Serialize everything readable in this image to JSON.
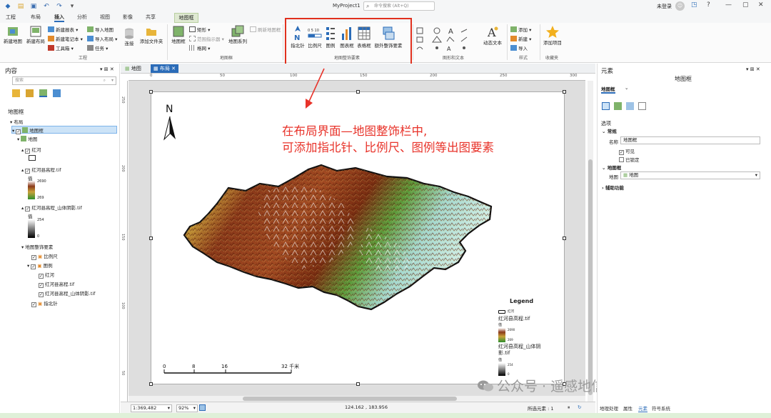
{
  "titlebar": {
    "project_name": "MyProject1",
    "search_placeholder": "命令搜索 (Alt+Q)",
    "login": "未登录",
    "avatar": "☺",
    "help": "?"
  },
  "ribbon_tabs": [
    "工程",
    "布局",
    "插入",
    "分析",
    "视图",
    "影像",
    "共享"
  ],
  "contextual_tab": "地图框",
  "ribbon": {
    "project_group": {
      "new_map": "新建地图",
      "new_layout": "新建布局",
      "new_report": "新建报表",
      "new_notebook": "新建笔记本",
      "toolbox": "工具箱",
      "import_map": "导入地图",
      "import_layout": "导入布局",
      "task": "任务",
      "connect": "连接",
      "add_folder": "添加文件夹",
      "label": "工程"
    },
    "mapframe_group": {
      "map_frame": "地图框",
      "rectangle": "矩形",
      "extent_indicator": "范围指示器",
      "grid": "格网",
      "map_series": "地图系列",
      "refresh": "刷新地图框",
      "label": "地图框"
    },
    "surround_group": {
      "north_arrow": "指北针",
      "scale_bar": "比例尺",
      "legend": "图例",
      "chart_frame": "图表框",
      "table_frame": "表格框",
      "more_elements": "额外整饰要素",
      "label": "地图整饰要素"
    },
    "graphics_group": {
      "dynamic_text": "动态文本",
      "label": "图形和文本"
    },
    "style_group": {
      "add": "添加",
      "new": "新建",
      "import": "导入",
      "label": "样式"
    },
    "favorites_group": {
      "add_item": "添加项目",
      "label": "收藏夹"
    }
  },
  "content_panel": {
    "title": "内容",
    "search_placeholder": "搜索",
    "section": "地图框",
    "tree": [
      {
        "label": "布局"
      },
      {
        "label": "地图框",
        "selected": true
      },
      {
        "label": "地图"
      },
      {
        "label": "红河"
      },
      {
        "label": "红河县高程.tif"
      },
      {
        "label": "值"
      },
      {
        "label": "2690"
      },
      {
        "label": "269"
      },
      {
        "label": "红河县高程_山体阴影.tif"
      },
      {
        "label": "值"
      },
      {
        "label": "254"
      },
      {
        "label": "0"
      },
      {
        "label": "地图整饰要素"
      },
      {
        "label": "比例尺"
      },
      {
        "label": "图例"
      },
      {
        "label": "红河"
      },
      {
        "label": "红河县高程.tif"
      },
      {
        "label": "红河县高程_山体阴影.tif"
      },
      {
        "label": "指北针"
      }
    ]
  },
  "doc_tabs": [
    "地图",
    "布局"
  ],
  "ruler_top": [
    "0",
    "50",
    "100",
    "150",
    "200",
    "250",
    "300"
  ],
  "ruler_left": [
    "250",
    "200",
    "150",
    "100",
    "50"
  ],
  "layout": {
    "north_label": "N",
    "annotation_line1": "在布局界面—地图整饰栏中,",
    "annotation_line2": "可添加指北针、比例尺、图例等出图要素",
    "scalebar_labels": [
      "0",
      "8",
      "16",
      "32 千米"
    ],
    "legend": {
      "title": "Legend",
      "items": [
        "红河",
        "红河县高程.tif",
        "值",
        "2690",
        "269",
        "红河县高程_山体阴影.tif",
        "值",
        "254",
        "0"
      ]
    },
    "watermark": "公众号 · 遥感地信是一家"
  },
  "status_bar": {
    "scale": "1:369,482",
    "zoom": "92%",
    "coords": "124.162 , 183.956",
    "selected": "所选元素 : 1"
  },
  "elements_panel": {
    "title": "元素",
    "subtitle": "地图框",
    "tab": "地图框",
    "options": "选项",
    "general": "常规",
    "name_label": "名称",
    "name_value": "地图框",
    "visible": "可见",
    "locked": "已锁定",
    "mapframe_section": "地图框",
    "map_label": "地图",
    "map_value": "地图",
    "aux": "辅助功能"
  },
  "bottom_tabs": [
    "地理处理",
    "属性",
    "元素",
    "符号系统"
  ],
  "colors": {
    "accent": "#2b6cb8",
    "highlight_red": "#e0301e",
    "annotation_red": "#e8332a",
    "contextual_green": "#dfe9d2"
  }
}
